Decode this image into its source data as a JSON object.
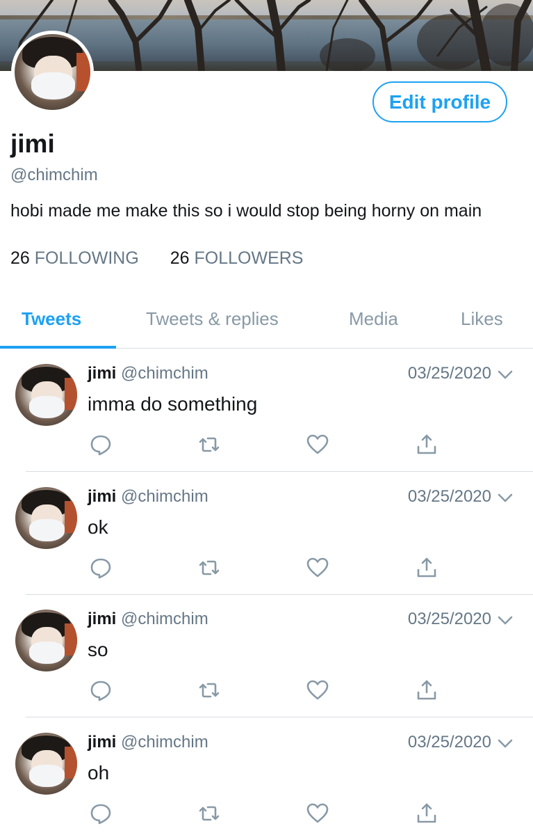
{
  "profile": {
    "display_name": "jimi",
    "handle": "@chimchim",
    "bio": "hobi made me make this so i would stop being horny on main",
    "edit_button": "Edit profile",
    "following_count": "26",
    "following_label": "FOLLOWING",
    "followers_count": "26",
    "followers_label": "FOLLOWERS"
  },
  "tabs": [
    {
      "label": "Tweets",
      "active": true
    },
    {
      "label": "Tweets & replies",
      "active": false
    },
    {
      "label": "Media",
      "active": false
    },
    {
      "label": "Likes",
      "active": false
    }
  ],
  "tweets": [
    {
      "name": "jimi",
      "handle": "@chimchim",
      "date": "03/25/2020",
      "text": "imma do something"
    },
    {
      "name": "jimi",
      "handle": "@chimchim",
      "date": "03/25/2020",
      "text": "ok"
    },
    {
      "name": "jimi",
      "handle": "@chimchim",
      "date": "03/25/2020",
      "text": "so"
    },
    {
      "name": "jimi",
      "handle": "@chimchim",
      "date": "03/25/2020",
      "text": "oh"
    }
  ],
  "icons": {
    "reply": "reply-icon",
    "retweet": "retweet-icon",
    "like": "heart-icon",
    "share": "share-icon",
    "menu": "chevron-down-icon"
  },
  "colors": {
    "accent": "#1da1f2",
    "secondary_text": "#657786",
    "icon": "#8899a6"
  }
}
